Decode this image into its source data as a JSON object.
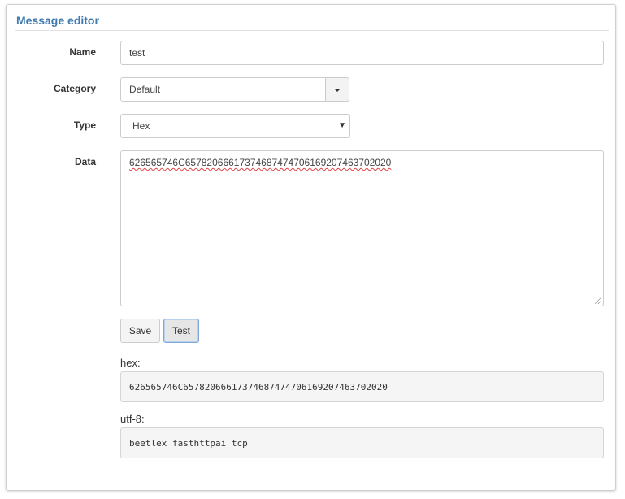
{
  "panel": {
    "title": "Message editor"
  },
  "form": {
    "name": {
      "label": "Name",
      "value": "test"
    },
    "category": {
      "label": "Category",
      "value": "Default"
    },
    "type": {
      "label": "Type",
      "value": "Hex"
    },
    "data": {
      "label": "Data",
      "value": "626565746C65782066617374687474706169207463702020"
    }
  },
  "buttons": {
    "save_label": "Save",
    "test_label": "Test"
  },
  "output": {
    "hex_label": "hex:",
    "hex_value": "626565746C65782066617374687474706169207463702020",
    "utf8_label": "utf-8:",
    "utf8_value": "beetlex fasthttpai tcp"
  }
}
